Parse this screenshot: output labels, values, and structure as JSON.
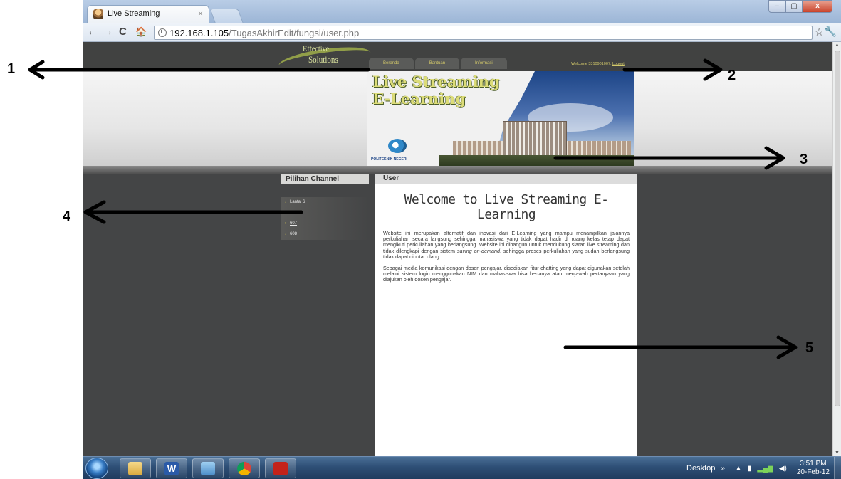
{
  "browser": {
    "tab_title": "Live Streaming",
    "tab_close": "×",
    "url_host": "192.168.1.105",
    "url_path": "/TugasAkhirEdit/fungsi/user.php",
    "window_controls": {
      "minimize": "–",
      "maximize": "▢",
      "close": "x"
    },
    "nav": {
      "back": "←",
      "forward": "→",
      "reload": "C",
      "home": "🏠",
      "bookmark": "☆",
      "settings": "🔧"
    }
  },
  "site": {
    "brand_line1": "Effective",
    "brand_line2": "Solutions",
    "menu": [
      "Beranda",
      "Bantuan",
      "Informasi"
    ],
    "welcome_text": "Welcome 3310901007, ",
    "logout_label": "Logout",
    "banner_title_line1": "Live Streaming",
    "banner_title_line2": "E-Learning",
    "banner_logo_text": "POLITEKNIK NEGERI"
  },
  "sidebar": {
    "heading": "Pilihan Channel",
    "chevron": "›",
    "channels": [
      "Lantai 6",
      "",
      "607",
      "608"
    ]
  },
  "main": {
    "heading": "User",
    "title": "Welcome to Live Streaming E-Learning",
    "para1_a": "Website ini merupakan alternatif dan inovasi dari E-Learning yang mampu menampilkan jalannya perkuliahan secara langsung sehingga mahasiswa yang tidak dapat hadir di ruang kelas tetap dapat mengikuti perkuliahan yang berlangsung. Website ini dibangun untuk mendukung siaran live streaming dan tidak dilengkapi dengan sistem ",
    "para1_em": "saving on-demand",
    "para1_b": ", sehingga proses perkuliahan yang sudah berlangsung tidak dapat diputar ulang.",
    "para2": "Sebagai media komunikasi dengan dosen pengajar, disediakan fitur chatting yang dapat digunakan setelah melalui sistem login menggunakan NIM dan mahasiswa bisa bertanya atau menjawab pertanyaan yang diajukan oleh dosen pengajar."
  },
  "annotations": [
    "1",
    "2",
    "3",
    "4",
    "5"
  ],
  "taskbar": {
    "desktop_label": "Desktop",
    "chevron": "»",
    "time": "3:51 PM",
    "date": "20-Feb-12"
  },
  "colors": {
    "page_bg": "#444546",
    "accent": "#d2c86a",
    "banner_title": "#dcdc78"
  }
}
